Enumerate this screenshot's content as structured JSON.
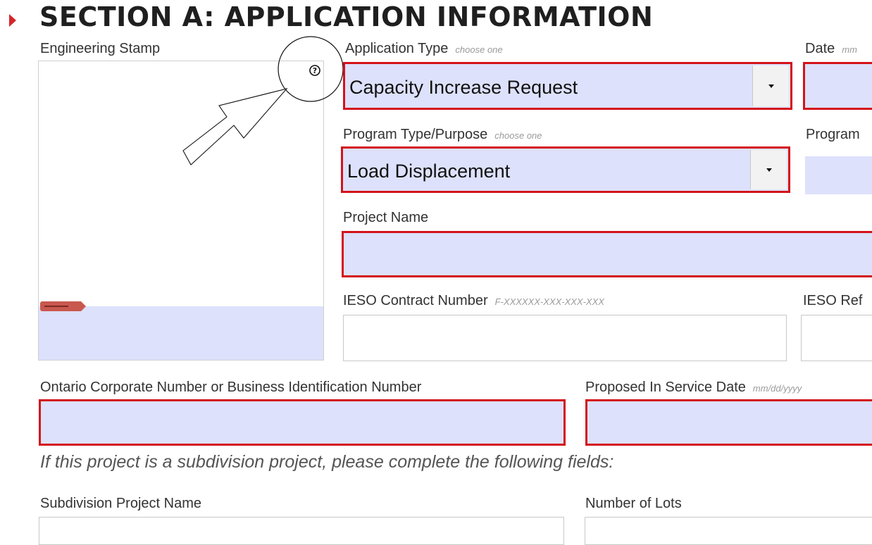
{
  "section": {
    "title": "SECTION A: APPLICATION INFORMATION"
  },
  "engineering_stamp": {
    "label": "Engineering Stamp",
    "help_icon": "help-circle-icon",
    "tag_icon": "ribbon-tag-icon"
  },
  "application_type": {
    "label": "Application Type",
    "hint": "choose one",
    "value": "Capacity Increase Request"
  },
  "date": {
    "label": "Date",
    "hint": "mm"
  },
  "program_type": {
    "label": "Program Type/Purpose",
    "hint": "choose one",
    "value": "Load Displacement"
  },
  "program_right": {
    "label": "Program"
  },
  "project_name": {
    "label": "Project Name"
  },
  "ieso_contract": {
    "label": "IESO Contract Number",
    "hint": "F-XXXXXX-XXX-XXX-XXX"
  },
  "ieso_ref": {
    "label": "IESO Ref"
  },
  "corporate_number": {
    "label": "Ontario Corporate Number or Business Identification Number"
  },
  "in_service_date": {
    "label": "Proposed In Service Date",
    "hint": "mm/dd/yyyy"
  },
  "subdivision_note": "If this project is a subdivision project, please complete the following fields:",
  "subdivision_name": {
    "label": "Subdivision Project Name"
  },
  "number_of_lots": {
    "label": "Number of Lots"
  },
  "colors": {
    "required_border": "#d4121a",
    "field_fill": "#dde1fb",
    "accent": "#d4252a"
  }
}
